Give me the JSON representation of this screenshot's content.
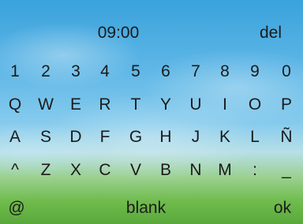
{
  "clock": {
    "time": "09:00"
  },
  "controls": {
    "del_label": "del",
    "at_label": "@",
    "blank_label": "blank",
    "ok_label": "ok"
  },
  "keyboard": {
    "row_digits": [
      "1",
      "2",
      "3",
      "4",
      "5",
      "6",
      "7",
      "8",
      "9",
      "0"
    ],
    "row_1": [
      "Q",
      "W",
      "E",
      "R",
      "T",
      "Y",
      "U",
      "I",
      "O",
      "P"
    ],
    "row_2": [
      "A",
      "S",
      "D",
      "F",
      "G",
      "H",
      "J",
      "K",
      "L",
      "Ñ"
    ],
    "row_3": [
      "^",
      "Z",
      "X",
      "C",
      "V",
      "B",
      "N",
      "M",
      ":",
      "_"
    ]
  }
}
